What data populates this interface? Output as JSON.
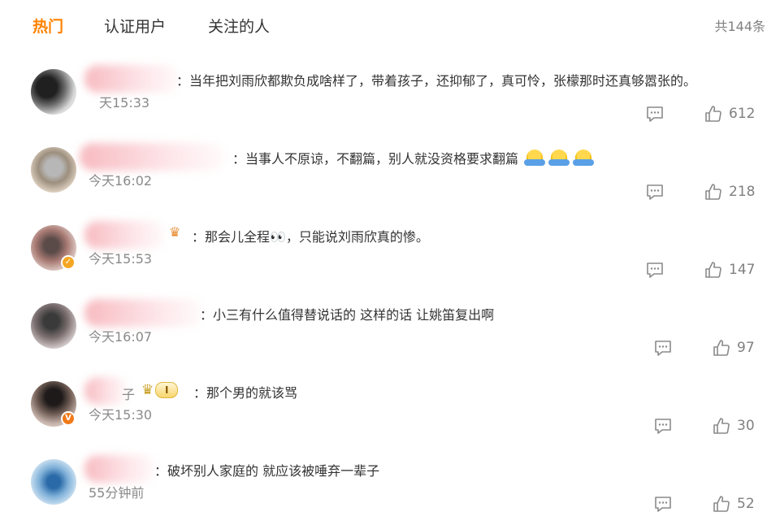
{
  "tabs": [
    {
      "label": "热门",
      "active": true
    },
    {
      "label": "认证用户",
      "active": false
    },
    {
      "label": "关注的人",
      "active": false
    }
  ],
  "total_count": "共144条",
  "colors": {
    "accent": "#ff8200",
    "text": "#333333",
    "muted": "#808080"
  },
  "icons": {
    "reply": "comment-icon",
    "like": "thumbs-up-icon",
    "crown": "crown-icon",
    "verified": "verified-badge-icon"
  },
  "comments": [
    {
      "text": "：当年把刘雨欣都欺负成啥样了，带着孩子，还抑郁了，真可怜，张檬那时还真够嚣张的。",
      "time": "天15:33",
      "likes": "612"
    },
    {
      "text": "：当事人不原谅，不翻篇，别人就没资格要求翻篇",
      "time": "今天16:02",
      "likes": "218",
      "emoji_count": 3
    },
    {
      "text": "：那会儿全程👀，只能说刘雨欣真的惨。",
      "time": "今天15:53",
      "likes": "147"
    },
    {
      "text": "：小三有什么值得替说话的 这样的话 让姚笛复出啊",
      "time": "今天16:07",
      "likes": "97"
    },
    {
      "name_suffix": "子",
      "vip_level": "I",
      "text": "：那个男的就该骂",
      "time": "今天15:30",
      "likes": "30"
    },
    {
      "text": "：破坏别人家庭的 就应该被唾弃一辈子",
      "time": "55分钟前",
      "likes": "52"
    }
  ]
}
